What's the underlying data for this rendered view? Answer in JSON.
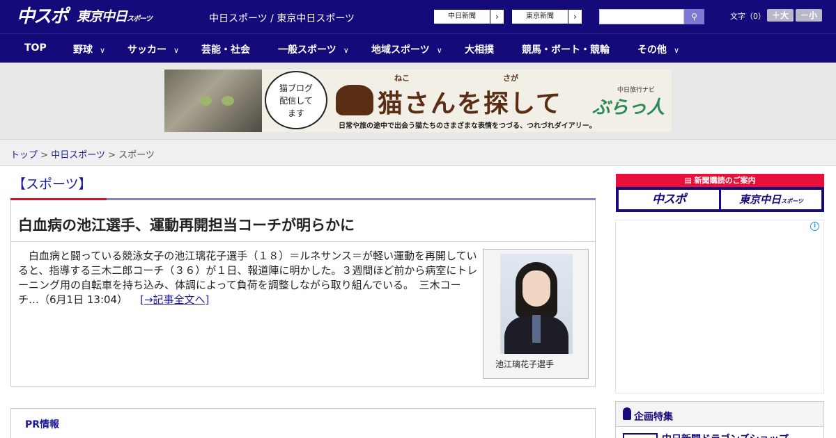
{
  "header": {
    "logo_chuspo": "中スポ",
    "logo_tokyo": "東京中日",
    "logo_tokyo_small": "スポーツ",
    "site_title": "中日スポーツ / 東京中日スポーツ",
    "paper_links": [
      {
        "label": "中日新聞",
        "arrow": "›"
      },
      {
        "label": "東京新聞",
        "arrow": "›"
      }
    ],
    "search": {
      "value": "",
      "icon": "search-icon",
      "glyph": "🔍"
    },
    "font_size": {
      "label": "文字（0）",
      "plus": "＋大",
      "minus": "－小"
    }
  },
  "nav": {
    "items": [
      {
        "label": "TOP",
        "dropdown": false
      },
      {
        "label": "野球",
        "dropdown": true
      },
      {
        "label": "サッカー",
        "dropdown": true
      },
      {
        "label": "芸能・社会",
        "dropdown": false
      },
      {
        "label": "一般スポーツ",
        "dropdown": true
      },
      {
        "label": "地域スポーツ",
        "dropdown": true
      },
      {
        "label": "大相撲",
        "dropdown": false
      },
      {
        "label": "競馬・ボート・競輪",
        "dropdown": false
      },
      {
        "label": "その他",
        "dropdown": true
      }
    ],
    "chevron": "∨"
  },
  "banner": {
    "bubble": "猫ブログ\n配信して\nます",
    "ruby_neko": "ねこ",
    "ruby_saga": "さが",
    "title": "猫さんを探して",
    "subtitle": "日常や旅の途中で出会う猫たちのさまざまな表情をつづる、つれづれダイアリー。",
    "brand_small": "中日旅行ナビ",
    "brand": "ぶらっ人"
  },
  "breadcrumb": {
    "items": [
      "トップ",
      "中日スポーツ",
      "スポーツ"
    ],
    "separator": ">"
  },
  "main": {
    "section_heading": "【スポーツ】",
    "article": {
      "title": "白血病の池江選手、運動再開担当コーチが明らかに",
      "body": "白血病と闘っている競泳女子の池江璃花子選手（１８）＝ルネサンス＝が軽い運動を再開していると、指導する三木二郎コーチ（３６）が１日、報道陣に明かした。３週間ほど前から病室にトレーニング用の自転車を持ち込み、体調によって負荷を調整しながら取り組んでいる。　三木コーチ…（6月1日 13:04）",
      "more_link": "[→記事全文へ]",
      "photo_caption": "池江璃花子選手"
    },
    "pr_title": "PR情報"
  },
  "sidebar": {
    "subscribe_head": "新聞購読のご案内",
    "subscribe_chuspo": "中スポ",
    "subscribe_tokyo": "東京中日",
    "subscribe_tokyo_small": "スポーツ",
    "ad_info": "i",
    "feature_title": "企画特集",
    "feature_item": "中日新聞ドラゴンズショップ"
  },
  "colors": {
    "brand_navy": "#150a7a",
    "link": "#1a1a9a",
    "accent_red": "#d8102a",
    "rule_purple": "#8a7fc0"
  }
}
